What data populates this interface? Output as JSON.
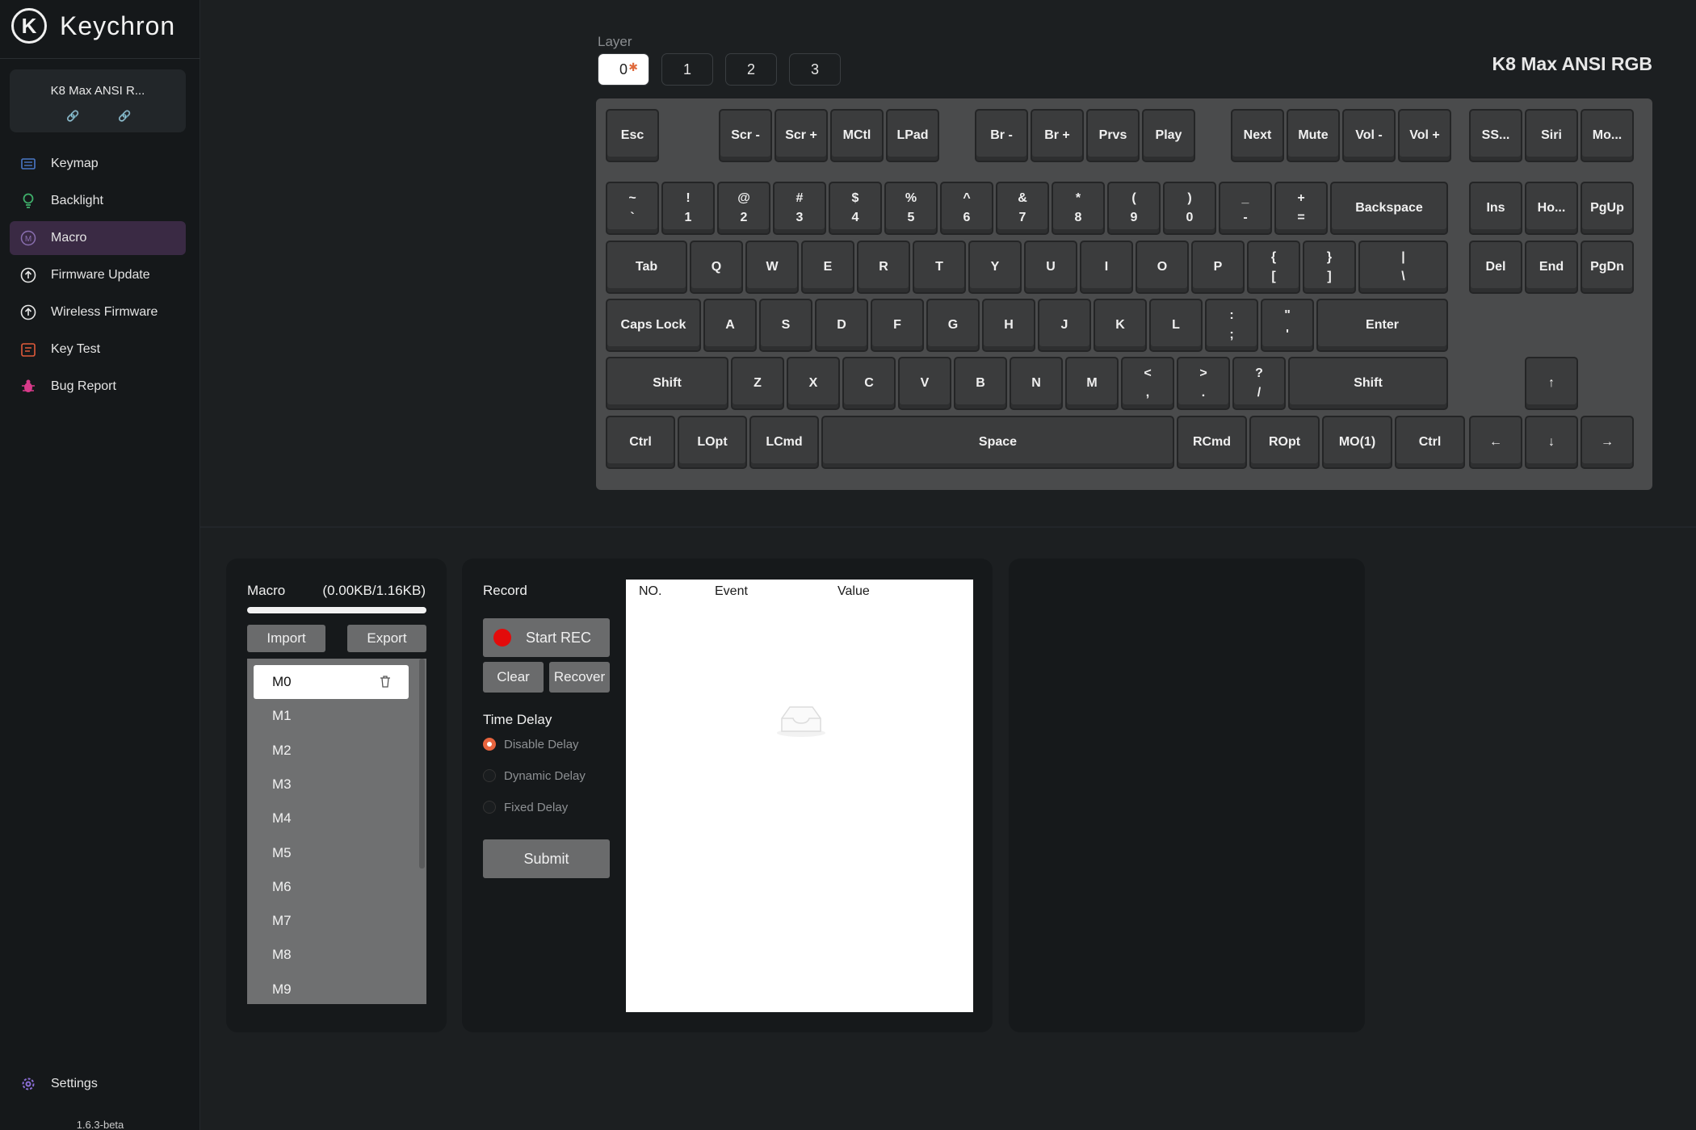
{
  "app": {
    "brand": "Keychron",
    "logo_letter": "K",
    "version": "1.6.3-beta"
  },
  "device": {
    "name": "K8 Max ANSI R...",
    "link1": "🔗",
    "link2": "🔗"
  },
  "nav": [
    {
      "label": "Keymap",
      "icon": "keyboard-icon",
      "active": false
    },
    {
      "label": "Backlight",
      "icon": "bulb-icon",
      "active": false
    },
    {
      "label": "Macro",
      "icon": "macro-icon",
      "active": true
    },
    {
      "label": "Firmware Update",
      "icon": "firmware-icon",
      "active": false
    },
    {
      "label": "Wireless Firmware",
      "icon": "wireless-firmware-icon",
      "active": false
    },
    {
      "label": "Key Test",
      "icon": "key-test-icon",
      "active": false
    },
    {
      "label": "Bug Report",
      "icon": "bug-icon",
      "active": false
    }
  ],
  "settings_label": "Settings",
  "layer": {
    "label": "Layer",
    "tabs": [
      "0",
      "1",
      "2",
      "3"
    ],
    "active": "0",
    "dot": "✱"
  },
  "keyboard_title": "K8 Max ANSI RGB",
  "keys": [
    [
      "Esc"
    ],
    [
      "Scr -"
    ],
    [
      "Scr +"
    ],
    [
      "MCtl"
    ],
    [
      "LPad"
    ],
    [
      "Br -"
    ],
    [
      "Br +"
    ],
    [
      "Prvs"
    ],
    [
      "Play"
    ],
    [
      "Next"
    ],
    [
      "Mute"
    ],
    [
      "Vol -"
    ],
    [
      "Vol +"
    ],
    [
      "SS..."
    ],
    [
      "Siri"
    ],
    [
      "Mo..."
    ],
    [
      "~",
      "`"
    ],
    [
      "!",
      "1"
    ],
    [
      "@",
      "2"
    ],
    [
      "#",
      "3"
    ],
    [
      "$",
      "4"
    ],
    [
      "%",
      "5"
    ],
    [
      "^",
      "6"
    ],
    [
      "&",
      "7"
    ],
    [
      "*",
      "8"
    ],
    [
      "(",
      "9"
    ],
    [
      ")",
      "0"
    ],
    [
      "_",
      "-"
    ],
    [
      "+",
      "="
    ],
    [
      "Backspace"
    ],
    [
      "Ins"
    ],
    [
      "Ho..."
    ],
    [
      "PgUp"
    ],
    [
      "Tab"
    ],
    [
      "Q"
    ],
    [
      "W"
    ],
    [
      "E"
    ],
    [
      "R"
    ],
    [
      "T"
    ],
    [
      "Y"
    ],
    [
      "U"
    ],
    [
      "I"
    ],
    [
      "O"
    ],
    [
      "P"
    ],
    [
      "{",
      "["
    ],
    [
      "}",
      "]"
    ],
    [
      "|",
      "\\"
    ],
    [
      "Del"
    ],
    [
      "End"
    ],
    [
      "PgDn"
    ],
    [
      "Caps Lock"
    ],
    [
      "A"
    ],
    [
      "S"
    ],
    [
      "D"
    ],
    [
      "F"
    ],
    [
      "G"
    ],
    [
      "H"
    ],
    [
      "J"
    ],
    [
      "K"
    ],
    [
      "L"
    ],
    [
      ":",
      ";"
    ],
    [
      "\"",
      "'"
    ],
    [
      "Enter"
    ],
    [
      "Shift"
    ],
    [
      "Z"
    ],
    [
      "X"
    ],
    [
      "C"
    ],
    [
      "V"
    ],
    [
      "B"
    ],
    [
      "N"
    ],
    [
      "M"
    ],
    [
      "<",
      ","
    ],
    [
      ">",
      "."
    ],
    [
      "?",
      "/"
    ],
    [
      "Shift"
    ],
    [
      "↑"
    ],
    [
      "Ctrl"
    ],
    [
      "LOpt"
    ],
    [
      "LCmd"
    ],
    [
      "Space"
    ],
    [
      "RCmd"
    ],
    [
      "ROpt"
    ],
    [
      "MO(1)"
    ],
    [
      "Ctrl"
    ],
    [
      "←"
    ],
    [
      "↓"
    ],
    [
      "→"
    ]
  ],
  "macro": {
    "title": "Macro",
    "usage": "(0.00KB/1.16KB)",
    "import_label": "Import",
    "export_label": "Export",
    "items": [
      "M0",
      "M1",
      "M2",
      "M3",
      "M4",
      "M5",
      "M6",
      "M7",
      "M8",
      "M9"
    ],
    "selected": "M0"
  },
  "record": {
    "title": "Record",
    "start_label": "Start REC",
    "clear_label": "Clear",
    "recover_label": "Recover",
    "delay_title": "Time Delay",
    "delay_options": [
      "Disable Delay",
      "Dynamic Delay",
      "Fixed Delay"
    ],
    "delay_selected": "Disable Delay",
    "submit_label": "Submit",
    "table_headers": [
      "NO.",
      "Event",
      "Value"
    ]
  },
  "colors": {
    "accent": "#e8643e",
    "rec": "#e30b0b",
    "nav_active": "#3a2a44"
  }
}
